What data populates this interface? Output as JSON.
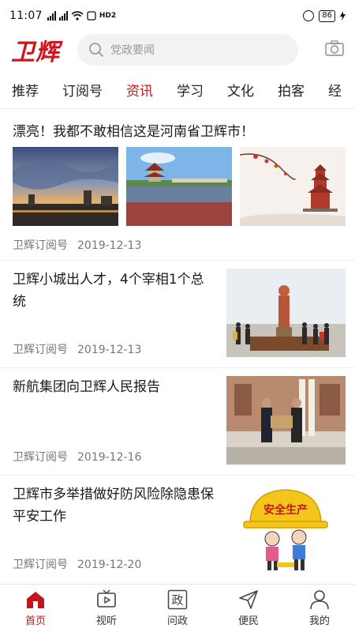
{
  "status_bar": {
    "time": "11:07",
    "network_label": "HD2",
    "battery": "86"
  },
  "header": {
    "logo": "卫辉",
    "search_placeholder": "党政要闻"
  },
  "tabs": [
    {
      "label": "推荐",
      "active": false
    },
    {
      "label": "订阅号",
      "active": false
    },
    {
      "label": "资讯",
      "active": true
    },
    {
      "label": "学习",
      "active": false
    },
    {
      "label": "文化",
      "active": false
    },
    {
      "label": "拍客",
      "active": false
    },
    {
      "label": "经",
      "active": false
    }
  ],
  "articles": [
    {
      "title": "漂亮！我都不敢相信这是河南省卫辉市！",
      "source": "卫辉订阅号",
      "date": "2019-12-13"
    },
    {
      "title": "卫辉小城出人才，4个宰相1个总统",
      "source": "卫辉订阅号",
      "date": "2019-12-13"
    },
    {
      "title": "新航集团向卫辉人民报告",
      "source": "卫辉订阅号",
      "date": "2019-12-16"
    },
    {
      "title": "卫辉市多举措做好防风险除隐患保平安工作",
      "source": "卫辉订阅号",
      "date": "2019-12-20",
      "image_text": "安全生产"
    }
  ],
  "bottom_nav": [
    {
      "label": "首页",
      "icon": "home-icon",
      "active": true
    },
    {
      "label": "视听",
      "icon": "tv-icon",
      "active": false
    },
    {
      "label": "问政",
      "icon": "politics-icon",
      "icon_text": "政",
      "active": false
    },
    {
      "label": "便民",
      "icon": "send-icon",
      "active": false
    },
    {
      "label": "我的",
      "icon": "user-icon",
      "active": false
    }
  ],
  "colors": {
    "accent": "#c3161c",
    "search_bg": "#f2f2f2",
    "meta_text": "#777777"
  }
}
